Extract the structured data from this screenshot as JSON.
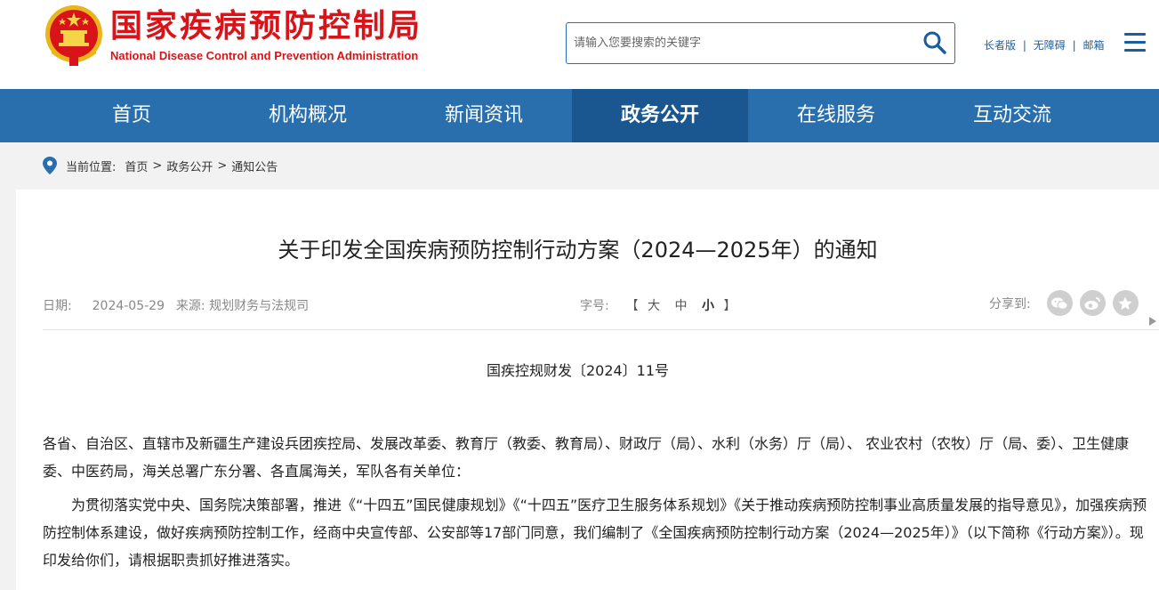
{
  "header": {
    "site_name_cn": "国家疾病预防控制局",
    "site_name_en": "National Disease Control and Prevention Administration",
    "search_placeholder": "请输入您要搜索的关键字",
    "links": [
      "长者版",
      "无障碍",
      "邮箱"
    ],
    "link_separator": "|"
  },
  "nav": {
    "items": [
      "首页",
      "机构概况",
      "新闻资讯",
      "政务公开",
      "在线服务",
      "互动交流"
    ],
    "active": "政务公开"
  },
  "breadcrumb": {
    "label": "当前位置:",
    "items": [
      "首页",
      "政务公开",
      "通知公告"
    ],
    "separator": ">"
  },
  "article": {
    "title": "关于印发全国疾病预防控制行动方案（2024—2025年）的通知",
    "date_label": "日期:",
    "date": "2024-05-29",
    "source_label": "来源:",
    "source": "规划财务与法规司",
    "font_label": "字号:",
    "font_bracket_open": "【",
    "font_bracket_close": "】",
    "font_sizes": [
      "大",
      "中",
      "小"
    ],
    "share_label": "分享到:",
    "share_icons": [
      "wechat-icon",
      "weibo-icon",
      "star-icon"
    ],
    "doc_number": "国疾控规财发〔2024〕11号",
    "paragraph1": "各省、自治区、直辖市及新疆生产建设兵团疾控局、发展改革委、教育厅（教委、教育局）、财政厅（局）、水利（水务）厅（局）、 农业农村（农牧）厅（局、委）、卫生健康委、中医药局，海关总署广东分署、各直属海关，军队各有关单位：",
    "paragraph2": "为贯彻落实党中央、国务院决策部署，推进《“十四五”国民健康规划》《“十四五”医疗卫生服务体系规划》《关于推动疾病预防控制事业高质量发展的指导意见》，加强疾病预防控制体系建设，做好疾病预防控制工作，经商中央宣传部、公安部等17部门同意，我们编制了《全国疾病预防控制行动方案（2024—2025年）》（以下简称《行动方案》）。现印发给你们，请根据职责抓好推进落实。"
  },
  "colors": {
    "brand_red": "#d8141a",
    "nav_blue": "#2a6fad",
    "nav_active": "#1a5690"
  }
}
